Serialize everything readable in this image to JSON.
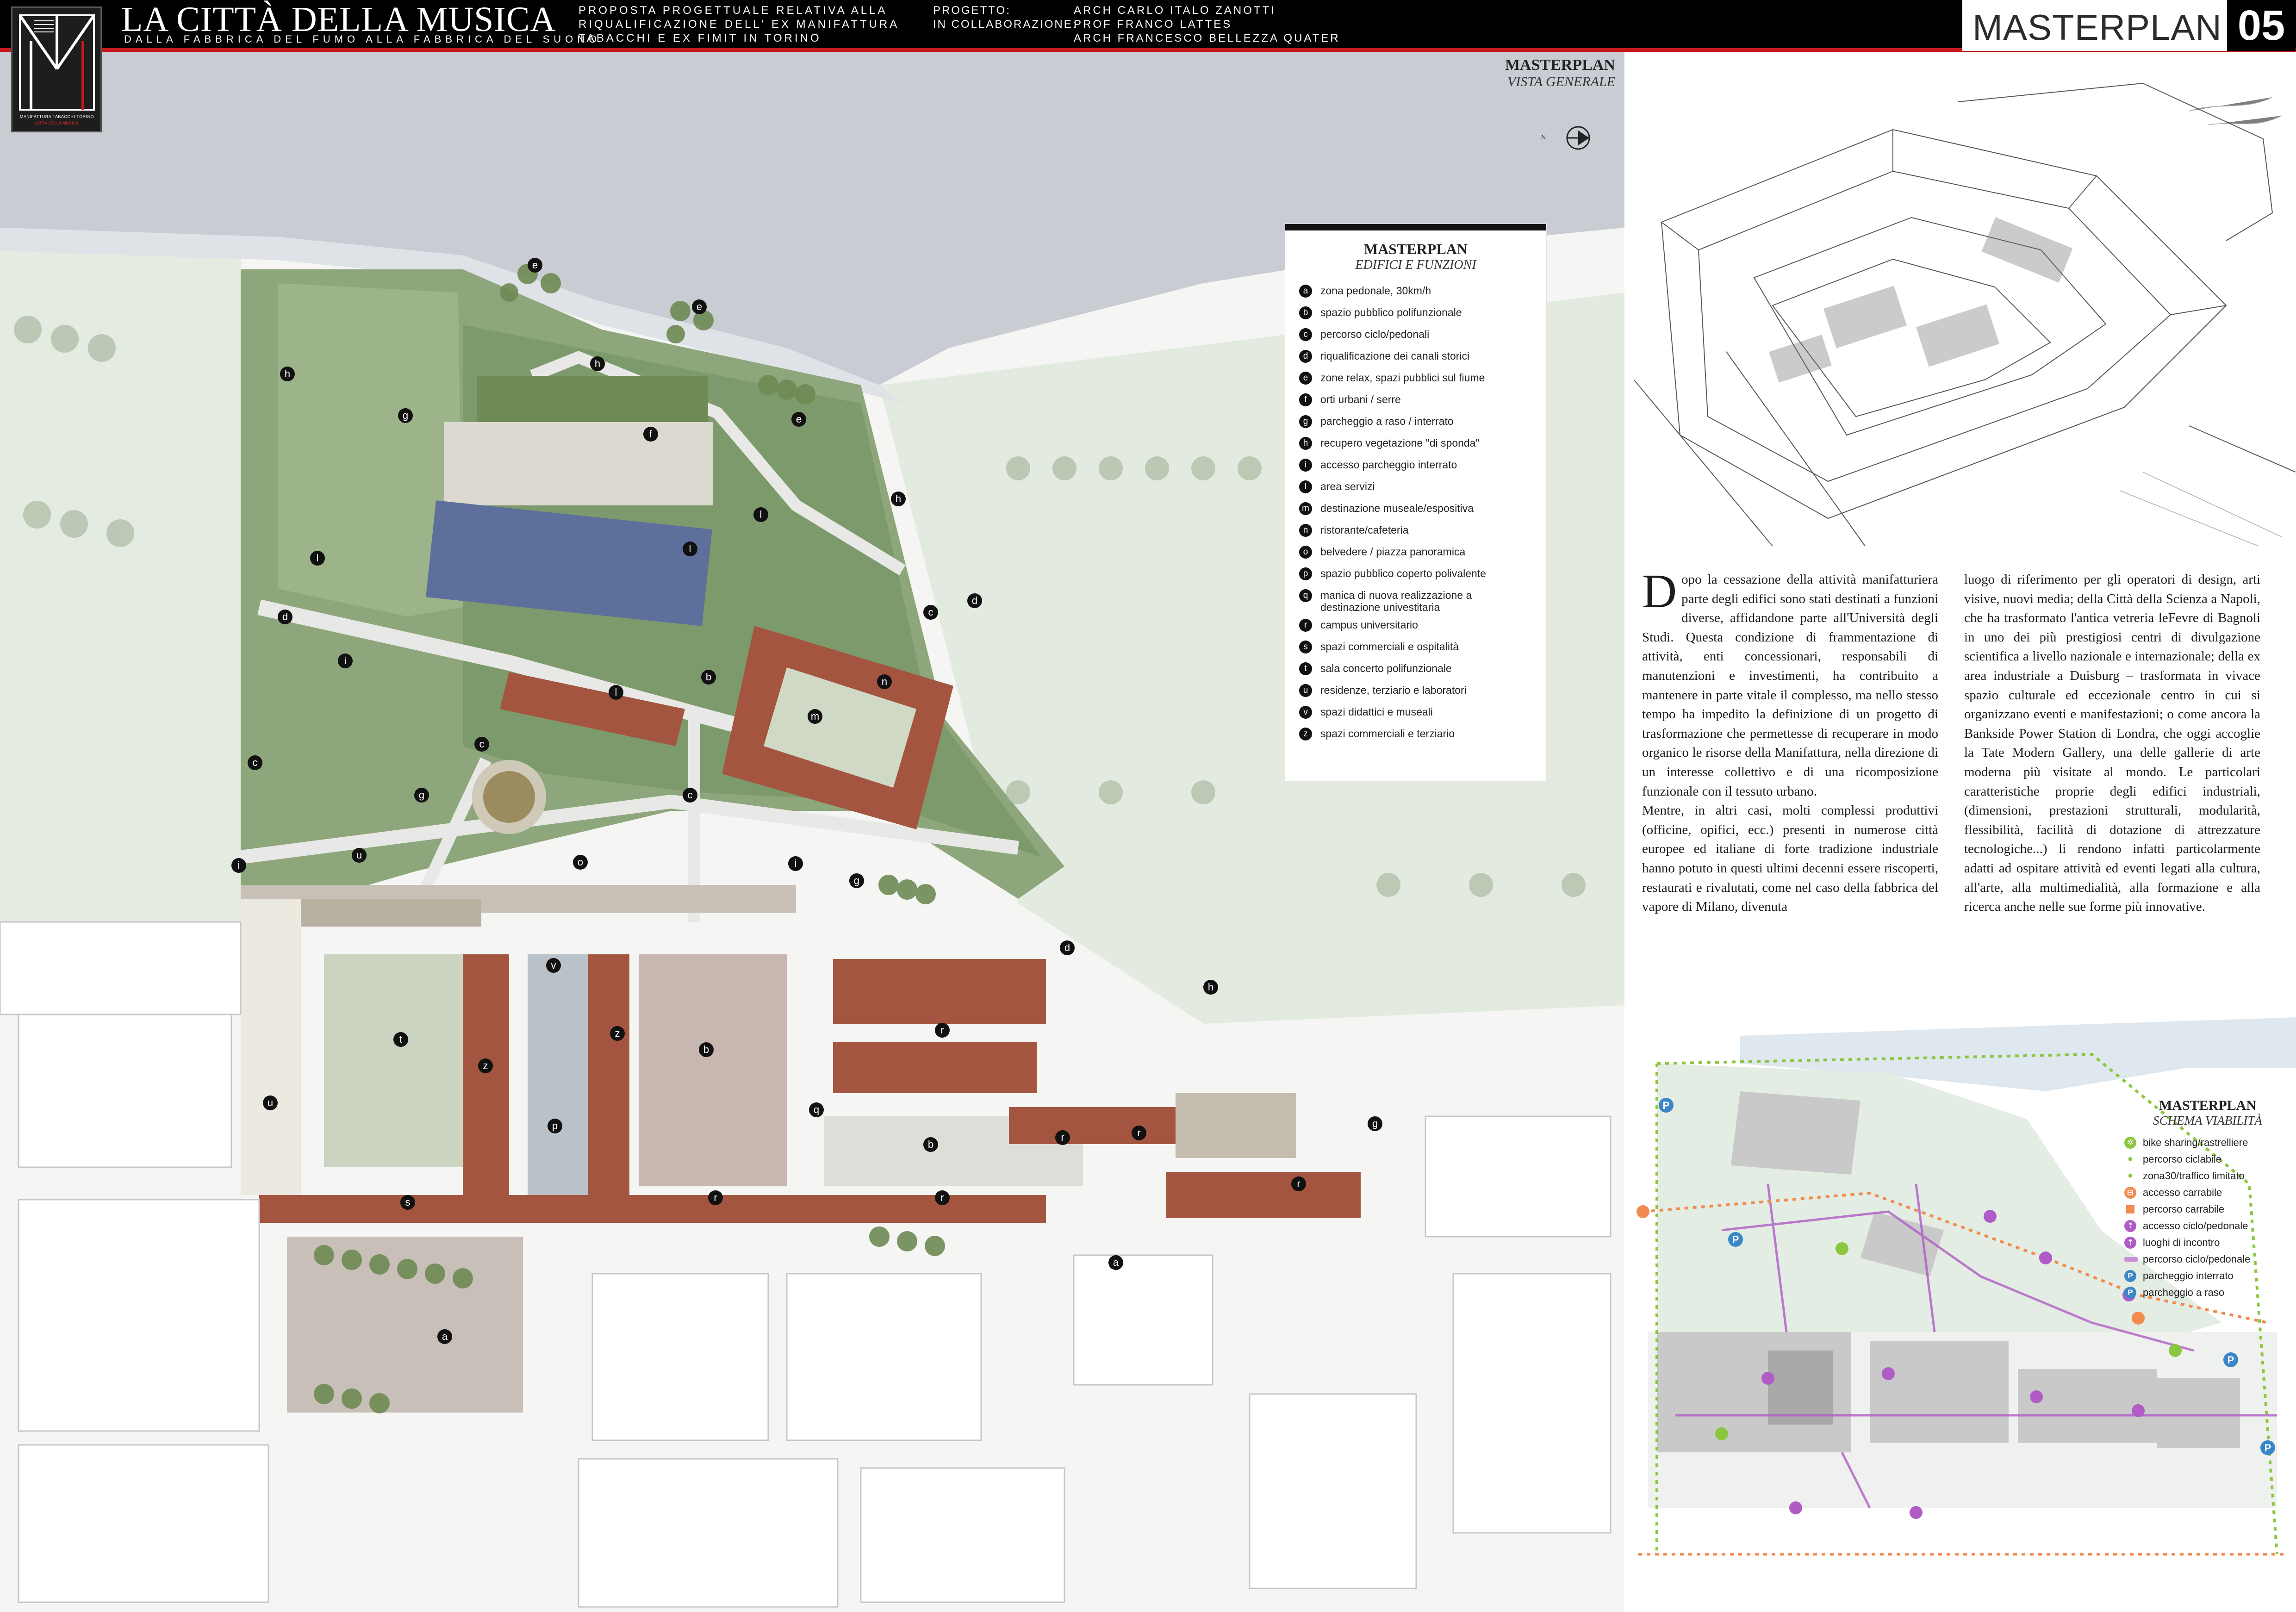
{
  "header": {
    "title": "LA CITTÀ DELLA MUSICA",
    "subtitle": "DALLA FABBRICA DEL FUMO ALLA FABBRICA DEL SUONO",
    "desc_line1": "PROPOSTA PROGETTUALE RELATIVA ALLA",
    "desc_line2": "RIQUALIFICAZIONE DELL' EX MANIFATTURA",
    "desc_line3": "TABACCHI E EX FIMIT IN TORINO",
    "proj_label1": "PROGETTO:",
    "proj_label2": "IN COLLABORAZIONE:",
    "name1": "ARCH CARLO ITALO ZANOTTI",
    "name2": "PROF FRANCO LATTES",
    "name3": "ARCH FRANCESCO BELLEZZA QUATER",
    "section_label": "MASTERPLAN",
    "section_number": "05",
    "logo_text1": "MANIFATTURA TABACCHI TORINO",
    "logo_text2": "CITTÀ DELLA MUSICA"
  },
  "map": {
    "caption_title": "MASTERPLAN",
    "caption_sub": "VISTA GENERALE",
    "compass_label": "N",
    "colors": {
      "river": "#c9ccd3",
      "park_dark": "#7d9a6c",
      "park_light": "#a8bd94",
      "paving": "#c7b7b0",
      "roof": "#a4553f",
      "context_bg": "#e3eadf",
      "building_white": "#ffffff"
    }
  },
  "legend": {
    "title": "MASTERPLAN",
    "subtitle": "EDIFICI E FUNZIONI",
    "items": [
      {
        "key": "a",
        "label": "zona pedonale, 30km/h"
      },
      {
        "key": "b",
        "label": "spazio pubblico polifunzionale"
      },
      {
        "key": "c",
        "label": "percorso ciclo/pedonali"
      },
      {
        "key": "d",
        "label": "riqualificazione dei canali storici"
      },
      {
        "key": "e",
        "label": "zone relax, spazi pubblici sul fiume"
      },
      {
        "key": "f",
        "label": "orti urbani / serre"
      },
      {
        "key": "g",
        "label": "parcheggio a raso / interrato"
      },
      {
        "key": "h",
        "label": "recupero vegetazione \"di sponda\""
      },
      {
        "key": "i",
        "label": "accesso parcheggio interrato"
      },
      {
        "key": "l",
        "label": "area servizi"
      },
      {
        "key": "m",
        "label": "destinazione museale/espositiva"
      },
      {
        "key": "n",
        "label": "ristorante/cafeteria"
      },
      {
        "key": "o",
        "label": "belvedere / piazza panoramica"
      },
      {
        "key": "p",
        "label": "spazio pubblico coperto polivalente"
      },
      {
        "key": "q",
        "label": "manica di nuova realizzazione a destinazione univestitaria"
      },
      {
        "key": "r",
        "label": "campus universitario"
      },
      {
        "key": "s",
        "label": "spazi commerciali e ospitalità"
      },
      {
        "key": "t",
        "label": "sala concerto polifunzionale"
      },
      {
        "key": "u",
        "label": "residenze, terziario e laboratori"
      },
      {
        "key": "v",
        "label": "spazi didattici e museali"
      },
      {
        "key": "z",
        "label": "spazi commerciali e terziario"
      }
    ]
  },
  "markers": {
    "a1": "a",
    "a2": "a",
    "b1": "b",
    "b2": "b",
    "b3": "b",
    "c1": "c",
    "c2": "c",
    "c3": "c",
    "c4": "c",
    "d1": "d",
    "d2": "d",
    "d3": "d",
    "e1": "e",
    "e2": "e",
    "e3": "e",
    "f1": "f",
    "g1": "g",
    "g2": "g",
    "g3": "g",
    "g4": "g",
    "h1": "h",
    "h2": "h",
    "h3": "h",
    "h4": "h",
    "i1": "i",
    "i2": "i",
    "i3": "i",
    "l1": "l",
    "l2": "l",
    "l3": "l",
    "l4": "l",
    "m1": "m",
    "n1": "n",
    "o1": "o",
    "p1": "p",
    "q1": "q",
    "r1": "r",
    "r2": "r",
    "r3": "r",
    "r4": "r",
    "r5": "r",
    "r6": "r",
    "s1": "s",
    "t1": "t",
    "u1": "u",
    "u2": "u",
    "v1": "v",
    "z1": "z",
    "z2": "z"
  },
  "text": {
    "col1_dropcap": "D",
    "col1": "opo la cessazione della attività manifatturiera parte degli edifici sono stati destinati a funzioni diverse, affidandone parte all'Università degli Studi. Questa condizione di frammentazione di attività, enti concessionari, responsabili di manutenzioni e investimenti, ha contribuito a mantenere in parte vitale il complesso, ma nello stesso tempo ha impedito la definizione di un progetto di trasformazione che permettesse di recuperare in modo organico le risorse della Manifattura, nella direzione di un interesse collettivo e di una ricomposizione funzionale con il tessuto urbano.",
    "col1b": "Mentre, in altri casi, molti complessi produttivi (officine, opifici, ecc.) presenti in numerose città europee ed italiane di forte tradizione industriale hanno potuto in questi ultimi decenni essere riscoperti, restaurati e rivalutati, come nel caso della fabbrica del vapore di Milano, divenuta",
    "col2": "luogo di riferimento per gli operatori di design, arti visive, nuovi media; della Città della Scienza a Napoli, che ha trasformato l'antica vetreria leFevre di Bagnoli in uno dei più prestigiosi centri di divulgazione scientifica a livello nazionale e internazionale; della ex area industriale a Duisburg – trasformata in vivace spazio culturale ed eccezionale centro in cui si organizzano eventi e manifestazioni; o come ancora la Bankside Power Station di Londra, che oggi accoglie la Tate Modern Gallery, una delle gallerie di arte moderna più visitate al mondo. Le particolari caratteristiche proprie degli edifici industriali, (dimensioni, prestazioni strutturali, modularità, flessibilità, facilità di dotazione di attrezzature tecnologiche...) li rendono infatti particolarmente adatti ad ospitare attività ed eventi legati alla cultura, all'arte, alla multimedialità, alla formazione e alla ricerca anche nelle sue forme più innovative."
  },
  "mini_legend": {
    "title": "MASTERPLAN",
    "subtitle": "SCHEMA VIABILITÀ",
    "items": [
      {
        "icon": "bike-sharing-icon",
        "color": "#8cc63f",
        "glyph": "✲",
        "label": "bike sharing/rastrelliere"
      },
      {
        "icon": "cycle-path-icon",
        "color": "#8cc63f",
        "glyph": "·",
        "label": "percorso ciclabile"
      },
      {
        "icon": "zone30-icon",
        "color": "#8cc63f",
        "glyph": "·",
        "label": "zona30/traffico limitato"
      },
      {
        "icon": "car-access-icon",
        "color": "#f08c50",
        "glyph": "⊟",
        "label": "accesso carrabile"
      },
      {
        "icon": "car-route-icon",
        "color": "#f08c50",
        "glyph": "·",
        "label": "percorso carrabile"
      },
      {
        "icon": "pedestrian-access-icon",
        "color": "#b05cc6",
        "glyph": "⇡",
        "label": "accesso ciclo/pedonale"
      },
      {
        "icon": "meeting-place-icon",
        "color": "#b05cc6",
        "glyph": "⇡",
        "label": "luoghi di incontro"
      },
      {
        "icon": "pedestrian-path-icon",
        "color": "#c98ed8",
        "glyph": "━",
        "label": "percorso ciclo/pedonale"
      },
      {
        "icon": "underground-parking-icon",
        "color": "#3a86c8",
        "glyph": "P",
        "label": "parcheggio interrato"
      },
      {
        "icon": "surface-parking-icon",
        "color": "#3a86c8",
        "glyph": "P",
        "label": "parcheggio a raso"
      }
    ]
  }
}
